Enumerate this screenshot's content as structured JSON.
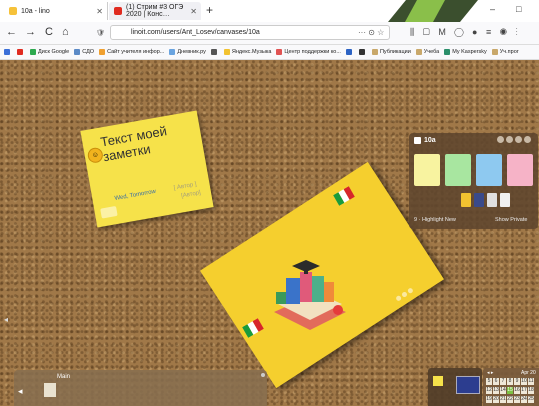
{
  "browser": {
    "tabs": [
      {
        "title": "10a - lino",
        "icon_color": "#f6c23a"
      },
      {
        "title": "(1) Стрим #3 ОГЭ 2020 | Конс…",
        "icon_color": "#e02b20"
      }
    ],
    "new_tab": "+",
    "window_controls": [
      "–",
      "□"
    ],
    "nav": {
      "back": "←",
      "forward": "→",
      "reload": "C",
      "home": "⌂"
    },
    "url": "linoit.com/users/Ant_Losev/canvases/10a",
    "url_actions": "··· ⊙ ☆",
    "toolbar_icons": "⫼ ▢ M ◯ ● ≡ ◉ ⋮"
  },
  "bookmarks": [
    {
      "label": "",
      "color": "#3b6fd8"
    },
    {
      "label": "",
      "color": "#e02b20"
    },
    {
      "label": "Диск Google",
      "color": "#2da94f"
    },
    {
      "label": "СДО",
      "color": "#5b8ac6"
    },
    {
      "label": "Сайт учителя инфор...",
      "color": "#f0a030"
    },
    {
      "label": "Дневник.ру",
      "color": "#6aa4e0"
    },
    {
      "label": "",
      "color": "#555"
    },
    {
      "label": "Яндекс.Музыка",
      "color": "#f2c230"
    },
    {
      "label": "Центр поддержки ко...",
      "color": "#e05252"
    },
    {
      "label": "",
      "color": "#2c63c4"
    },
    {
      "label": "",
      "color": "#333"
    },
    {
      "label": "Публикации",
      "color": "#c9a86a"
    },
    {
      "label": "Учеба",
      "color": "#c9a86a"
    },
    {
      "label": "My Kaspersky",
      "color": "#2b8f6a"
    },
    {
      "label": "Уч.прог",
      "color": "#c9a86a"
    }
  ],
  "sticky_note": {
    "title": "Текст моей заметки",
    "date": "Wed, Tomorrow",
    "author1": "[ Автор ]",
    "author2": "[Автор]",
    "color": "#f6e24a"
  },
  "big_note": {
    "color": "#f5cf2e"
  },
  "palette": {
    "title": "10a",
    "swatches": [
      "#f8f3a0",
      "#a8e6a0",
      "#8ec9f0",
      "#f6b3c7"
    ],
    "highlight_label": "9 · Highlight New",
    "show_private_label": "Show Private"
  },
  "bottom_panel": {
    "title": "Main"
  },
  "calendar": {
    "header": "Apr 20",
    "rows": [
      [
        "5",
        "6",
        "7",
        "8",
        "9",
        "10",
        "11"
      ],
      [
        "12",
        "13",
        "14",
        "15",
        "16",
        "17",
        "18"
      ],
      [
        "19",
        "20",
        "21",
        "22",
        "23",
        "24",
        "25"
      ]
    ],
    "today": "15"
  }
}
